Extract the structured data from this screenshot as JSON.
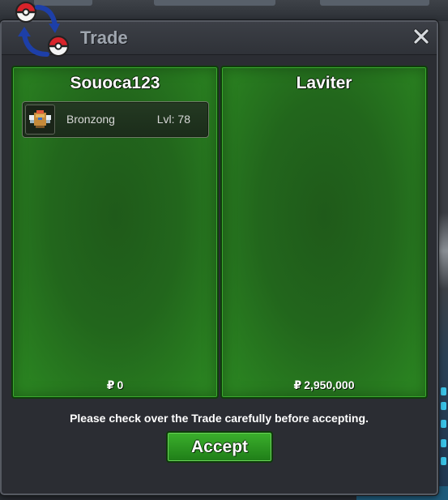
{
  "window": {
    "title": "Trade"
  },
  "trade": {
    "left": {
      "player": "Souoca123",
      "items": [
        {
          "name": "Bronzong",
          "level": "Lvl: 78"
        }
      ],
      "money": "0"
    },
    "right": {
      "player": "Laviter",
      "items": [],
      "money": "2,950,000"
    },
    "currency_symbol": "₽"
  },
  "footer": {
    "notice": "Please check over the Trade carefully before accepting.",
    "accept_label": "Accept"
  },
  "icons": {
    "trade": "trade-swap-icon",
    "close": "close-icon",
    "item": "bronzong-sprite-icon"
  },
  "colors": {
    "panel_green": "#22661c",
    "accept_green": "#2f9a24",
    "title_gray": "#9ea5ae"
  }
}
